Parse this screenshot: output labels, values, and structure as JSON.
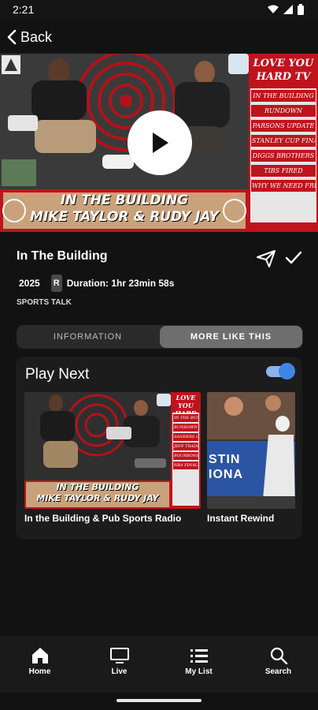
{
  "status_bar": {
    "time": "2:21"
  },
  "nav": {
    "back_label": "Back"
  },
  "video": {
    "side_panel_heading": "LOVE YOU HARD TV",
    "side_panel_items": [
      "IN THE BUILDING",
      "RUNDOWN",
      "PARSONS UPDATE",
      "STANLEY CUP FINALS",
      "DIGGS BROTHERS",
      "TIBS FIRED",
      "WHY WE NEED FREE MONEY"
    ],
    "banner_line1": "IN THE BUILDING",
    "banner_line2": "MIKE TAYLOR & RUDY JAY"
  },
  "show": {
    "title": "In The Building",
    "year": "2025",
    "rating": "R",
    "duration": "Duration: 1hr 23min 58s",
    "genre": "SPORTS TALK"
  },
  "tabs": [
    {
      "label": "INFORMATION",
      "active": false
    },
    {
      "label": "MORE LIKE THIS",
      "active": true
    }
  ],
  "play_next": {
    "heading": "Play Next",
    "autoplay_on": true,
    "items": [
      {
        "title": "In the Building & Pub Sports Radio",
        "panel_heading": "LOVE YOU HARD",
        "panel_items": [
          "IN THE BUILDING",
          "RUNDOWN",
          "SANDERS OUT",
          "JEFF TRADE",
          "BOURBONS",
          "NBA FINALS"
        ],
        "banner_line1": "IN THE BUILDING",
        "banner_line2": "MIKE TAYLOR & RUDY JAY"
      },
      {
        "title": "Instant Rewind",
        "sign_text": "STIN IONA"
      }
    ]
  },
  "bottom_nav": [
    {
      "label": "Home",
      "icon": "home-icon"
    },
    {
      "label": "Live",
      "icon": "tv-icon"
    },
    {
      "label": "My List",
      "icon": "list-icon"
    },
    {
      "label": "Search",
      "icon": "search-icon"
    }
  ],
  "colors": {
    "toggle_on": "#3e86e6",
    "tab_active": "#6e6e6e",
    "banner_red": "#c0131d"
  }
}
